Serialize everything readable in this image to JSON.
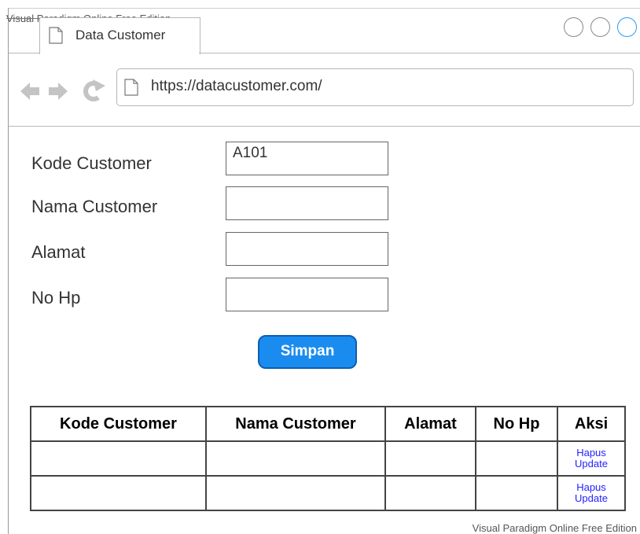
{
  "watermark_top": "Visual Paradigm Online Free Edition",
  "watermark_bottom": "Visual Paradigm Online Free Edition",
  "browser": {
    "tab_title": "Data Customer",
    "url": "https://datacustomer.com/"
  },
  "form": {
    "kode_label": "Kode Customer",
    "kode_value": "A101",
    "nama_label": "Nama Customer",
    "nama_value": "",
    "alamat_label": "Alamat",
    "alamat_value": "",
    "nohp_label": "No Hp",
    "nohp_value": "",
    "submit_label": "Simpan"
  },
  "table": {
    "headers": [
      "Kode Customer",
      "Nama Customer",
      "Alamat",
      "No Hp",
      "Aksi"
    ],
    "rows": [
      {
        "kode": "",
        "nama": "",
        "alamat": "",
        "nohp": "",
        "hapus": "Hapus",
        "update": "Update"
      },
      {
        "kode": "",
        "nama": "",
        "alamat": "",
        "nohp": "",
        "hapus": "Hapus",
        "update": "Update"
      }
    ]
  },
  "colors": {
    "accent": "#1a8cf0",
    "link": "#2222ff"
  }
}
